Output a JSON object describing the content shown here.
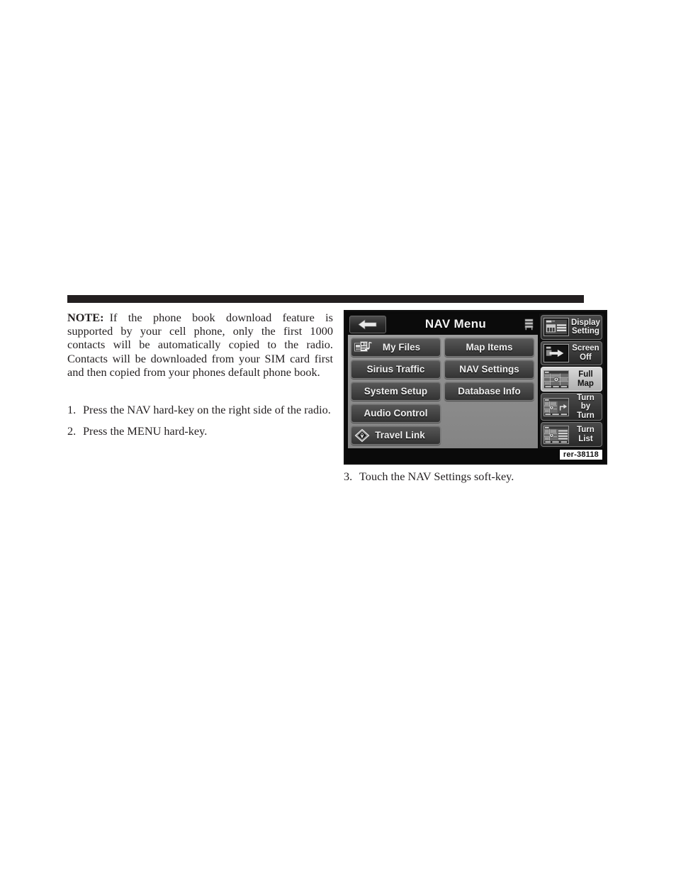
{
  "page": {
    "note": {
      "label": "NOTE:",
      "body": "If the phone book download feature is supported by your cell phone, only the first 1000 contacts will be automatically copied to the radio. Contacts will be downloaded from your SIM card first and then copied from your phones default phone book."
    },
    "steps": [
      {
        "number": "1.",
        "text": "Press the NAV hard-key on the right side of the radio."
      },
      {
        "number": "2.",
        "text": "Press the MENU hard-key."
      }
    ],
    "caption_step": {
      "number": "3.",
      "text": "Touch the NAV Settings soft-key."
    }
  },
  "figure": {
    "id_tag": "rer-38118",
    "nav_screen": {
      "title": "NAV Menu",
      "back_icon": "back-arrow-icon",
      "layers_icon": "layers-icon",
      "soft_keys_left": [
        {
          "label": "My Files",
          "icon": "media-files-icon"
        },
        {
          "label": "Sirius Traffic",
          "icon": ""
        },
        {
          "label": "System Setup",
          "icon": ""
        },
        {
          "label": "Audio Control",
          "icon": ""
        },
        {
          "label": "Travel Link",
          "icon": "travel-link-diamond-icon"
        }
      ],
      "soft_keys_right": [
        {
          "label": "Map Items",
          "icon": ""
        },
        {
          "label": "NAV Settings",
          "icon": ""
        },
        {
          "label": "Database Info",
          "icon": ""
        }
      ],
      "side_keys": [
        {
          "label": "Display\nSetting",
          "thumb": "display-setting-thumb",
          "selected": false
        },
        {
          "label": "Screen\nOff",
          "thumb": "screen-off-thumb",
          "selected": false
        },
        {
          "label": "Full\nMap",
          "thumb": "full-map-thumb",
          "selected": true
        },
        {
          "label": "Turn by\nTurn",
          "thumb": "turn-by-turn-thumb",
          "selected": false
        },
        {
          "label": "Turn\nList",
          "thumb": "turn-list-thumb",
          "selected": false
        }
      ]
    }
  },
  "colors": {
    "ink": "#231f20",
    "screen_bg": "#0a0a0a",
    "panel_grey": "#8e8e8e",
    "key_face": "#474747",
    "selected_key": "#c3c3c3"
  }
}
